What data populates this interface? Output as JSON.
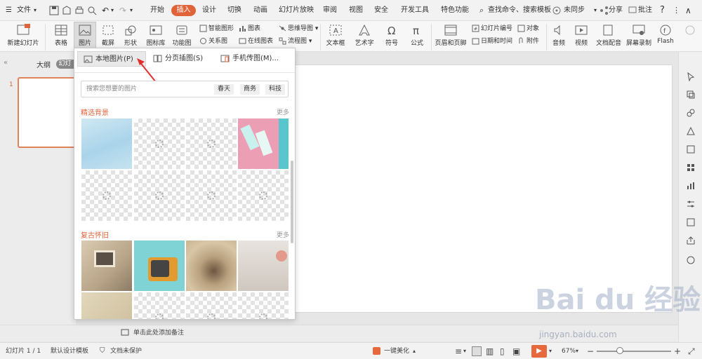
{
  "menubar": {
    "file": "文件",
    "tabs": [
      "开始",
      "插入",
      "设计",
      "切换",
      "动画",
      "幻灯片放映",
      "审阅",
      "视图",
      "安全",
      "开发工具",
      "特色功能"
    ],
    "active_tab": "插入",
    "search": "查找命令、搜索模板",
    "sync": "未同步",
    "share": "分享",
    "comment": "批注"
  },
  "ribbon": {
    "new_slide": "新建幻灯片",
    "table": "表格",
    "picture": "图片",
    "screenshot": "截屏",
    "shape": "形状",
    "icon_lib": "图标库",
    "func_chart": "功能图",
    "smart_art": "智能图形",
    "chart": "图表",
    "mind_map": "思维导图",
    "relation": "关系图",
    "online_chart": "在线图表",
    "flowchart": "流程图",
    "textbox": "文本框",
    "art_text": "艺术字",
    "symbol": "符号",
    "formula": "公式",
    "header_footer": "页眉和页脚",
    "slide_number": "幻灯片编号",
    "datetime": "日期和时间",
    "object": "对象",
    "attachment": "附件",
    "audio": "音频",
    "video": "视频",
    "doc_voice": "文档配音",
    "screen_rec": "屏幕录制",
    "flash": "Flash"
  },
  "leftpanel": {
    "outline": "大纲",
    "slides": "幻灯片",
    "slide_num": "1"
  },
  "dropdown": {
    "options": [
      "本地图片(P)",
      "分页插图(S)",
      "手机传图(M)..."
    ],
    "search_placeholder": "搜索您想要的图片",
    "tags": [
      "春天",
      "商务",
      "科技"
    ],
    "section1": "精选背景",
    "section2": "复古怀旧",
    "more": "更多"
  },
  "notes": {
    "placeholder": "单击此处添加备注"
  },
  "statusbar": {
    "slide_info": "幻灯片 1 / 1",
    "template": "默认设计模板",
    "protect": "文档未保护",
    "beautify": "一键美化",
    "zoom": "67%"
  },
  "watermark": {
    "brand": "Bai du 经验",
    "url": "jingyan.baidu.com"
  },
  "colors": {
    "accent": "#e0633a",
    "play": "#e8683d"
  }
}
